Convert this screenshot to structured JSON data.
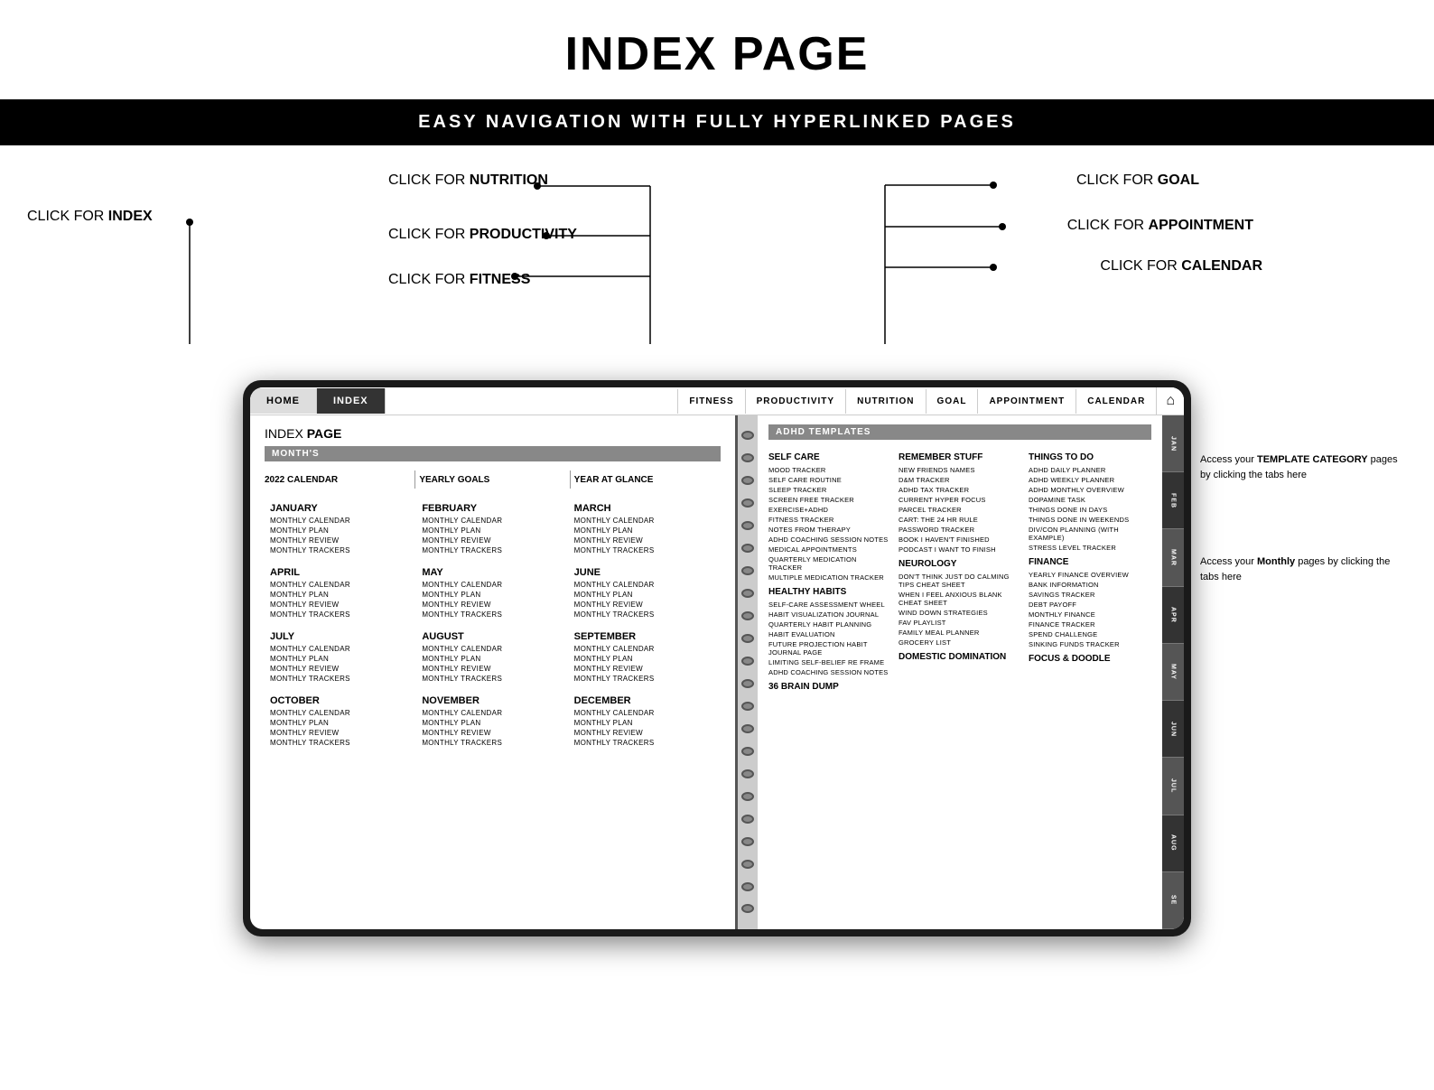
{
  "header": {
    "title": "INDEX PAGE",
    "subtitle": "EASY NAVIGATION WITH FULLY HYPERLINKED PAGES"
  },
  "annotations": {
    "index": "CLICK FOR INDEX",
    "nutrition": "CLICK FOR NUTRITION",
    "productivity": "CLICK FOR PRODUCTIVITY",
    "fitness": "CLICK FOR FITNESS",
    "goal": "CLICK FOR GOAL",
    "appointment": "CLICK FOR APPOINTMENT",
    "calendar": "CLICK FOR CALENDAR"
  },
  "top_nav_left": {
    "tabs": [
      "HOME",
      "INDEX"
    ]
  },
  "top_nav_right": {
    "tabs": [
      "FITNESS",
      "PRODUCTIVITY",
      "NUTRITION",
      "GOAL",
      "APPOINTMENT",
      "CALENDAR"
    ]
  },
  "left_panel": {
    "title_plain": "INDEX",
    "title_bold": "PAGE",
    "months_label": "MONTH'S",
    "year_row": [
      {
        "label": "2022 CALENDAR"
      },
      {
        "label": "YEARLY GOALS",
        "bold": true
      },
      {
        "label": "YEAR AT GLANCE"
      }
    ],
    "months": [
      {
        "name": "JANUARY",
        "items": [
          "MONTHLY CALENDAR",
          "MONTHLY PLAN",
          "MONTHLY REVIEW",
          "MONTHLY TRACKERS"
        ]
      },
      {
        "name": "FEBRUARY",
        "items": [
          "MONTHLY CALENDAR",
          "MONTHLY PLAN",
          "MONTHLY REVIEW",
          "MONTHLY TRACKERS"
        ]
      },
      {
        "name": "MARCH",
        "items": [
          "MONTHLY CALENDAR",
          "MONTHLY PLAN",
          "MONTHLY REVIEW",
          "MONTHLY TRACKERS"
        ]
      },
      {
        "name": "APRIL",
        "items": [
          "MONTHLY CALENDAR",
          "MONTHLY PLAN",
          "MONTHLY REVIEW",
          "MONTHLY TRACKERS"
        ]
      },
      {
        "name": "MAY",
        "items": [
          "MONTHLY CALENDAR",
          "MONTHLY PLAN",
          "MONTHLY REVIEW",
          "MONTHLY TRACKERS"
        ]
      },
      {
        "name": "JUNE",
        "items": [
          "MONTHLY CALENDAR",
          "MONTHLY PLAN",
          "MONTHLY REVIEW",
          "MONTHLY TRACKERS"
        ]
      },
      {
        "name": "JULY",
        "items": [
          "MONTHLY CALENDAR",
          "MONTHLY PLAN",
          "MONTHLY REVIEW",
          "MONTHLY TRACKERS"
        ]
      },
      {
        "name": "AUGUST",
        "items": [
          "MONTHLY CALENDAR",
          "MONTHLY PLAN",
          "MONTHLY REVIEW",
          "MONTHLY TRACKERS"
        ]
      },
      {
        "name": "SEPTEMBER",
        "items": [
          "MONTHLY CALENDAR",
          "MONTHLY PLAN",
          "MONTHLY REVIEW",
          "MONTHLY TRACKERS"
        ]
      },
      {
        "name": "OCTOBER",
        "items": [
          "MONTHLY CALENDAR",
          "MONTHLY PLAN",
          "MONTHLY REVIEW",
          "MONTHLY TRACKERS"
        ]
      },
      {
        "name": "NOVEMBER",
        "items": [
          "MONTHLY CALENDAR",
          "MONTHLY PLAN",
          "MONTHLY REVIEW",
          "MONTHLY TRACKERS"
        ]
      },
      {
        "name": "DECEMBER",
        "items": [
          "MONTHLY CALENDAR",
          "MONTHLY PLAN",
          "MONTHLY REVIEW",
          "MONTHLY TRACKERS"
        ]
      }
    ]
  },
  "right_panel": {
    "adhd_title": "ADHD TEMPLATES",
    "col1": {
      "sections": [
        {
          "title": "SELF CARE",
          "items": [
            "MOOD TRACKER",
            "SELF CARE  ROUTINE",
            "SLEEP TRACKER",
            "SCREEN  FREE TRACKER",
            "EXERCISE+ADHD",
            "FITNESS TRACKER",
            "NOTES FROM THERAPY",
            "ADHD COACHING SESSION NOTES",
            "MEDICAL APPOINTMENTS",
            "QUARTERLY MEDICATION TRACKER",
            "MULTIPLE MEDICATION  TRACKER"
          ]
        },
        {
          "title": "HEALTHY HABITS",
          "items": [
            "SELF-CARE  ASSESSMENT WHEEL",
            "HABIT VISUALIZATION JOURNAL",
            "QUARTERLY HABIT PLANNING",
            "HABIT EVALUATION",
            "FUTURE PROJECTION HABIT JOURNAL PAGE",
            "LIMITING SELF-BELIEF RE FRAME",
            "ADHD COACHING SESSION NOTES"
          ]
        },
        {
          "title": "36 BRAIN DUMP",
          "items": []
        }
      ]
    },
    "col2": {
      "sections": [
        {
          "title": "REMEMBER STUFF",
          "items": [
            "NEW FRIENDS NAMES",
            "D&M TRACKER",
            "ADHD TAX TRACKER",
            "CURRENT HYPER FOCUS",
            "PARCEL TRACKER",
            "CART: THE 24 HR RULE",
            "PASSWORD TRACKER",
            "BOOK I HAVEN'T  FINISHED",
            "PODCAST I WANT TO FINISH"
          ]
        },
        {
          "title": "NEUROLOGY",
          "items": [
            "DON'T THINK JUST DO CALMING TIPS CHEAT SHEET",
            "WHEN I FEEL ANXIOUS BLANK CHEAT SHEET",
            "WIND DOWN STRATEGIES",
            "FAV PLAYLIST",
            "FAMILY MEAL PLANNER",
            "GROCERY LIST"
          ]
        },
        {
          "title": "DOMESTIC DOMINATION",
          "items": []
        }
      ]
    },
    "col3": {
      "sections": [
        {
          "title": "THINGS TO DO",
          "items": [
            "ADHD DAILY PLANNER",
            "ADHD WEEKLY PLANNER",
            "ADHD MONTHLY OVERVIEW",
            "DOPAMINE TASK",
            "THINGS DONE IN DAYS",
            "THINGS DONE IN WEEKENDS",
            "DIV/CON PLANNING (WITH EXAMPLE)",
            "STRESS LEVEL TRACKER"
          ]
        },
        {
          "title": "FINANCE",
          "items": [
            "YEARLY FINANCE OVERVIEW",
            "BANK INFORMATION",
            "SAVINGS TRACKER",
            "DEBT PAYOFF",
            "MONTHLY FINANCE",
            "FINANCE TRACKER",
            "SPEND CHALLENGE",
            "SINKING FUNDS TRACKER"
          ]
        },
        {
          "title": "FOCUS & DOODLE",
          "items": []
        }
      ]
    }
  },
  "side_tabs": [
    "JAN",
    "FEB",
    "MAR",
    "APR",
    "MAY",
    "JUN",
    "JUL",
    "AUG",
    "SE"
  ],
  "right_annotations": {
    "template": "Access your TEMPLATE CATEGORY pages by clicking the tabs here",
    "monthly": "Access your Monthly pages by clicking the tabs here"
  }
}
